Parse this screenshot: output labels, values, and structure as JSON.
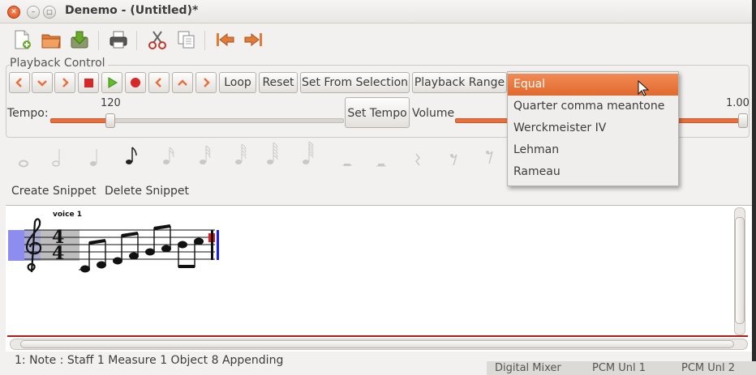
{
  "window": {
    "title": "Denemo - (Untitled)*",
    "close_glyph": "✕",
    "minimize_glyph": "–",
    "maximize_glyph": "□"
  },
  "toolbar": {
    "icons": [
      "new-file-icon",
      "open-folder-icon",
      "save-icon",
      "print-icon",
      "cut-icon",
      "copy-icon",
      "go-to-start-icon",
      "go-to-end-icon"
    ]
  },
  "playback": {
    "frame_label": "Playback Control",
    "icon_buttons": [
      "rewind-icon",
      "down-icon",
      "forward-icon",
      "stop-icon",
      "play-icon",
      "record-icon",
      "previous-icon",
      "up-icon",
      "next-icon"
    ],
    "loop_label": "Loop",
    "reset_label": "Reset",
    "set_from_selection_label": "Set From Selection",
    "playback_range_label": "Playback Range",
    "tempo_label": "Tempo:",
    "tempo_value": "120",
    "set_tempo_label": "Set Tempo",
    "volume_label": "Volume",
    "volume_value": "1.00",
    "accent": "#e8703e"
  },
  "temperament_dropdown": {
    "options": [
      "Equal",
      "Quarter comma meantone",
      "Werckmeister IV",
      "Lehman",
      "Rameau"
    ],
    "selected": "Equal"
  },
  "note_palette": {
    "icons": [
      "whole-note-icon",
      "half-note-icon",
      "quarter-note-icon",
      "eighth-note-icon",
      "sixteenth-note-icon",
      "thirty-second-note-icon",
      "sixty-fourth-note-icon",
      "hundred-twenty-eighth-note-icon",
      "two-hundred-fifty-sixth-note-icon",
      "whole-rest-icon",
      "half-rest-icon",
      "quarter-rest-icon",
      "eighth-rest-icon",
      "sixteenth-rest-icon"
    ]
  },
  "snippets": {
    "create_label": "Create Snippet",
    "delete_label": "Delete Snippet"
  },
  "score": {
    "voice_label": "voice 1",
    "time_sig_top": "4",
    "time_sig_bottom": "4"
  },
  "status": {
    "text": "1: Note :  Staff 1 Measure 1 Object 8 Appending"
  },
  "background_windows": {
    "item1": "Digital Mixer",
    "item2": "PCM Unl 1",
    "item3": "PCM Unl 2"
  }
}
